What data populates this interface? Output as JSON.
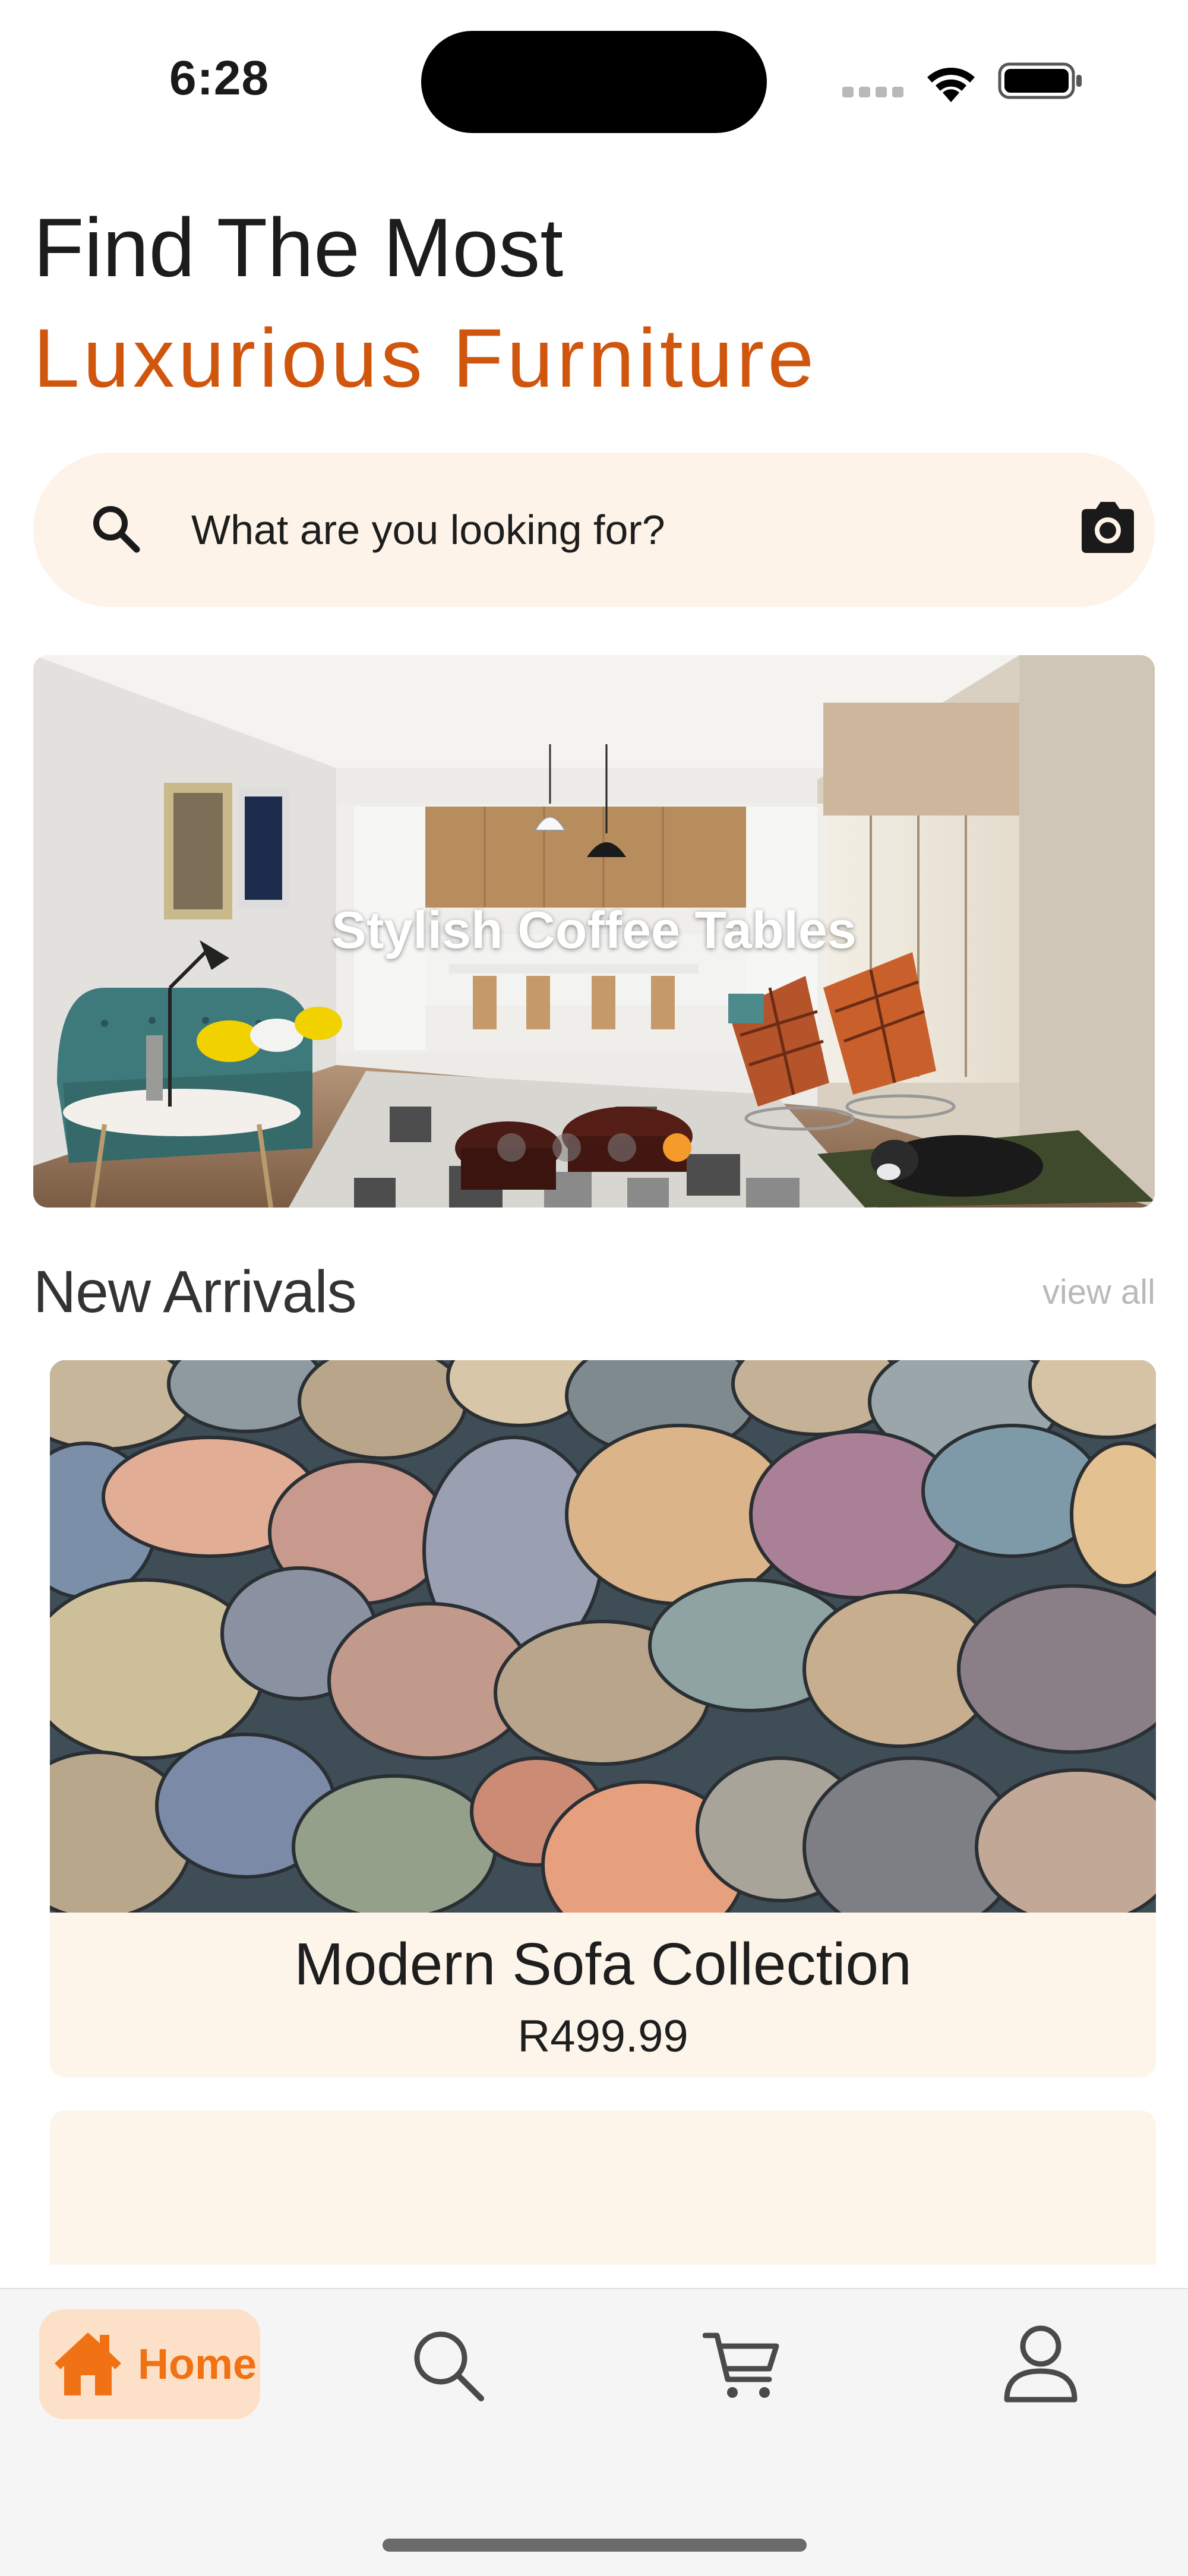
{
  "status_bar": {
    "time": "6:28"
  },
  "header": {
    "line1": "Find The Most",
    "line2": "Luxurious Furniture"
  },
  "search": {
    "placeholder": "What are you looking for?"
  },
  "banner": {
    "title": "Stylish Coffee Tables",
    "slide_count": 4,
    "active_slide": 4
  },
  "new_arrivals": {
    "title": "New Arrivals",
    "view_all": "view all",
    "products": [
      {
        "name": "Modern Sofa Collection",
        "price": "R499.99"
      }
    ]
  },
  "bottom_nav": {
    "items": [
      {
        "label": "Home",
        "icon": "home-icon",
        "active": true
      },
      {
        "label": "",
        "icon": "search-icon",
        "active": false
      },
      {
        "label": "",
        "icon": "cart-icon",
        "active": false
      },
      {
        "label": "",
        "icon": "profile-icon",
        "active": false
      }
    ]
  },
  "colors": {
    "accent": "#d0560e",
    "nav_active": "#f07214",
    "search_bg": "#fdf3e8",
    "card_bg": "#fdf5ea",
    "dot_active": "#f59b2c"
  }
}
